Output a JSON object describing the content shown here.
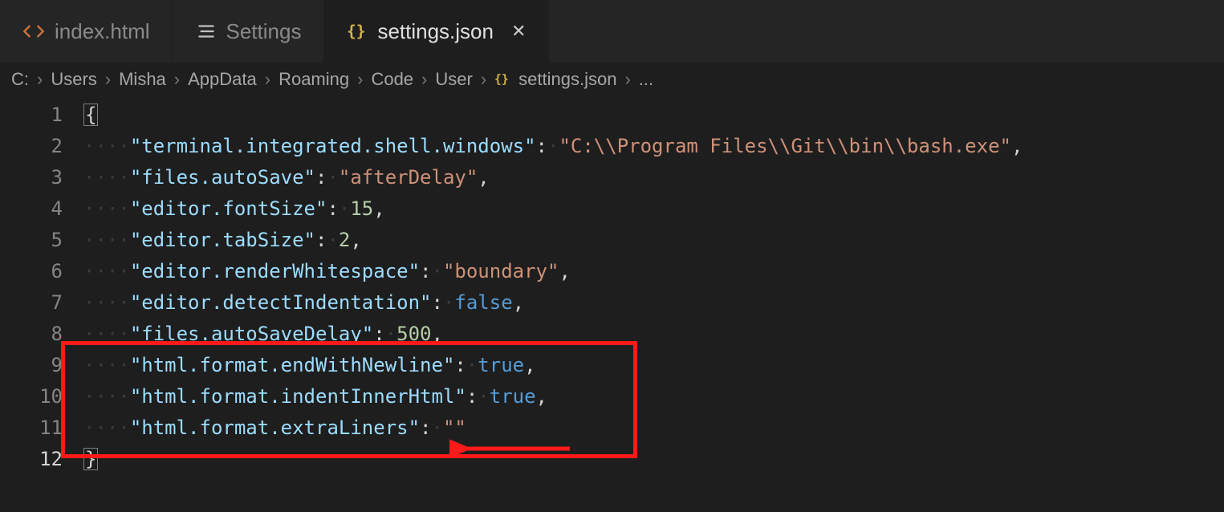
{
  "tabs": [
    {
      "label": "index.html",
      "type": "html"
    },
    {
      "label": "Settings",
      "type": "settings"
    },
    {
      "label": "settings.json",
      "type": "json"
    }
  ],
  "activeTab": 2,
  "breadcrumb": {
    "parts": [
      "C:",
      "Users",
      "Misha",
      "AppData",
      "Roaming",
      "Code",
      "User"
    ],
    "file": "settings.json",
    "trailing": "..."
  },
  "code": {
    "lines": [
      {
        "n": 1,
        "kind": "open"
      },
      {
        "n": 2,
        "kind": "kv",
        "key": "terminal.integrated.shell.windows",
        "valType": "str",
        "val": "C:\\\\Program Files\\\\Git\\\\bin\\\\bash.exe",
        "comma": true
      },
      {
        "n": 3,
        "kind": "kv",
        "key": "files.autoSave",
        "valType": "str",
        "val": "afterDelay",
        "comma": true
      },
      {
        "n": 4,
        "kind": "kv",
        "key": "editor.fontSize",
        "valType": "num",
        "val": "15",
        "comma": true
      },
      {
        "n": 5,
        "kind": "kv",
        "key": "editor.tabSize",
        "valType": "num",
        "val": "2",
        "comma": true
      },
      {
        "n": 6,
        "kind": "kv",
        "key": "editor.renderWhitespace",
        "valType": "str",
        "val": "boundary",
        "comma": true
      },
      {
        "n": 7,
        "kind": "kv",
        "key": "editor.detectIndentation",
        "valType": "bool",
        "val": "false",
        "comma": true
      },
      {
        "n": 8,
        "kind": "kv",
        "key": "files.autoSaveDelay",
        "valType": "num",
        "val": "500",
        "comma": true
      },
      {
        "n": 9,
        "kind": "kv",
        "key": "html.format.endWithNewline",
        "valType": "bool",
        "val": "true",
        "comma": true
      },
      {
        "n": 10,
        "kind": "kv",
        "key": "html.format.indentInnerHtml",
        "valType": "bool",
        "val": "true",
        "comma": true
      },
      {
        "n": 11,
        "kind": "kv",
        "key": "html.format.extraLiners",
        "valType": "str",
        "val": "",
        "comma": false
      },
      {
        "n": 12,
        "kind": "close"
      }
    ],
    "activeLine": 12
  }
}
